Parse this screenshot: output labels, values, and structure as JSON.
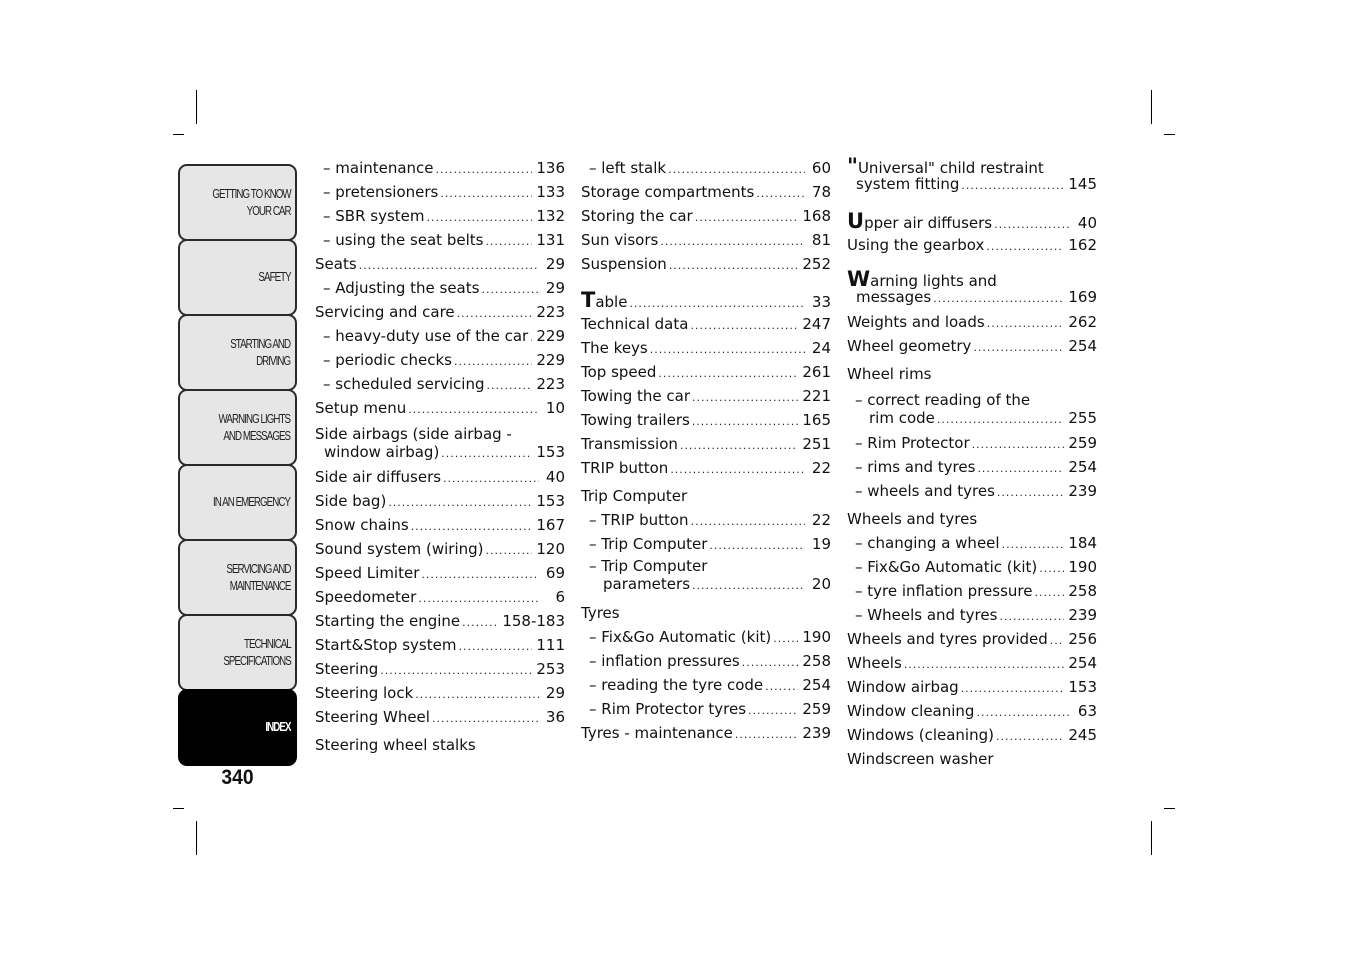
{
  "page_number": "340",
  "section_tabs": [
    {
      "label": "GETTING TO KNOW\nYOUR CAR",
      "active": false
    },
    {
      "label": "SAFETY",
      "active": false
    },
    {
      "label": "STARTING AND\nDRIVING",
      "active": false
    },
    {
      "label": "WARNING LIGHTS\nAND MESSAGES",
      "active": false
    },
    {
      "label": "IN AN EMERGENCY",
      "active": false
    },
    {
      "label": "SERVICING AND\nMAINTENANCE",
      "active": false
    },
    {
      "label": "TECHNICAL\nSPECIFICATIONS",
      "active": false
    },
    {
      "label": "INDEX",
      "active": true
    }
  ],
  "columns": [
    {
      "entries": [
        {
          "text": "– maintenance",
          "page": "136",
          "level": "sub"
        },
        {
          "text": "– pretensioners",
          "page": "133",
          "level": "sub"
        },
        {
          "text": "– SBR system",
          "page": "132",
          "level": "sub"
        },
        {
          "text": "– using the seat belts",
          "page": "131",
          "level": "sub"
        },
        {
          "text": "Seats",
          "page": "29",
          "level": "main"
        },
        {
          "text": "– Adjusting the seats",
          "page": "29",
          "level": "sub"
        },
        {
          "text": "Servicing and care",
          "page": "223",
          "level": "main"
        },
        {
          "text": "– heavy-duty use of the car",
          "page": "229",
          "level": "sub"
        },
        {
          "text": "– periodic checks",
          "page": "229",
          "level": "sub"
        },
        {
          "text": "– scheduled servicing",
          "page": "223",
          "level": "sub"
        },
        {
          "text": "Setup menu",
          "page": "10",
          "level": "main"
        },
        {
          "text": "Side airbags (side airbag -",
          "text2": "window airbag)",
          "page": "153",
          "level": "main"
        },
        {
          "text": "Side air diffusers",
          "page": "40",
          "level": "main"
        },
        {
          "text": "Side bag)",
          "page": "153",
          "level": "main"
        },
        {
          "text": "Snow chains",
          "page": "167",
          "level": "main"
        },
        {
          "text": "Sound system (wiring)",
          "page": "120",
          "level": "main"
        },
        {
          "text": "Speed Limiter",
          "page": "69",
          "level": "main"
        },
        {
          "text": "Speedometer",
          "page": "6",
          "level": "main"
        },
        {
          "text": "Starting the engine",
          "page": "158-183",
          "level": "main"
        },
        {
          "text": "Start&Stop system",
          "page": "111",
          "level": "main"
        },
        {
          "text": "Steering",
          "page": "253",
          "level": "main"
        },
        {
          "text": "Steering lock",
          "page": "29",
          "level": "main"
        },
        {
          "text": "Steering Wheel",
          "page": "36",
          "level": "main"
        },
        {
          "text": "Steering wheel stalks",
          "page": "",
          "level": "head"
        }
      ]
    },
    {
      "entries": [
        {
          "text": "– left stalk",
          "page": "60",
          "level": "sub"
        },
        {
          "text": "Storage compartments",
          "page": "78",
          "level": "main"
        },
        {
          "text": "Storing the car",
          "page": "168",
          "level": "main"
        },
        {
          "text": "Sun visors",
          "page": "81",
          "level": "main"
        },
        {
          "text": "Suspension",
          "page": "252",
          "level": "main"
        },
        {
          "text": "Table",
          "page": "33",
          "level": "main",
          "letter": "T"
        },
        {
          "text": "Technical data",
          "page": "247",
          "level": "main"
        },
        {
          "text": "The keys",
          "page": "24",
          "level": "main"
        },
        {
          "text": "Top speed",
          "page": "261",
          "level": "main"
        },
        {
          "text": "Towing the car",
          "page": "221",
          "level": "main"
        },
        {
          "text": "Towing trailers",
          "page": "165",
          "level": "main"
        },
        {
          "text": "Transmission",
          "page": "251",
          "level": "main"
        },
        {
          "text": "TRIP button",
          "page": "22",
          "level": "main"
        },
        {
          "text": "Trip Computer",
          "page": "",
          "level": "head"
        },
        {
          "text": "– TRIP button",
          "page": "22",
          "level": "sub"
        },
        {
          "text": "– Trip Computer",
          "page": "19",
          "level": "sub"
        },
        {
          "text": "– Trip Computer",
          "text2": "parameters",
          "page": "20",
          "level": "sub"
        },
        {
          "text": "Tyres",
          "page": "",
          "level": "head"
        },
        {
          "text": "– Fix&Go Automatic (kit)",
          "page": "190",
          "level": "sub"
        },
        {
          "text": "– inflation pressures",
          "page": "258",
          "level": "sub"
        },
        {
          "text": "– reading the tyre code",
          "page": "254",
          "level": "sub"
        },
        {
          "text": "– Rim Protector tyres",
          "page": "259",
          "level": "sub"
        },
        {
          "text": "Tyres - maintenance",
          "page": "239",
          "level": "main"
        }
      ]
    },
    {
      "entries": [
        {
          "text": "\"Universal\" child restraint",
          "text2": "system fitting",
          "page": "145",
          "level": "main",
          "letter": "\""
        },
        {
          "text": "Upper air diffusers",
          "page": "40",
          "level": "main",
          "letter": "U"
        },
        {
          "text": "Using the gearbox",
          "page": "162",
          "level": "main"
        },
        {
          "text": "Warning lights and",
          "text2": "messages",
          "page": "169",
          "level": "main",
          "letter": "W"
        },
        {
          "text": "Weights and loads",
          "page": "262",
          "level": "main"
        },
        {
          "text": "Wheel geometry",
          "page": "254",
          "level": "main"
        },
        {
          "text": "Wheel rims",
          "page": "",
          "level": "head"
        },
        {
          "text": "– correct reading of the",
          "text2": "rim code",
          "page": "255",
          "level": "sub"
        },
        {
          "text": "– Rim Protector",
          "page": "259",
          "level": "sub"
        },
        {
          "text": "– rims and tyres",
          "page": "254",
          "level": "sub"
        },
        {
          "text": "– wheels and tyres",
          "page": "239",
          "level": "sub"
        },
        {
          "text": "Wheels and tyres",
          "page": "",
          "level": "head"
        },
        {
          "text": "– changing a wheel",
          "page": "184",
          "level": "sub"
        },
        {
          "text": "– Fix&Go Automatic (kit)",
          "page": "190",
          "level": "sub"
        },
        {
          "text": "– tyre inflation pressure",
          "page": "258",
          "level": "sub"
        },
        {
          "text": "– Wheels and tyres",
          "page": "239",
          "level": "sub"
        },
        {
          "text": "Wheels and tyres provided",
          "page": "256",
          "level": "main"
        },
        {
          "text": "Wheels",
          "page": "254",
          "level": "main"
        },
        {
          "text": "Window airbag",
          "page": "153",
          "level": "main"
        },
        {
          "text": "Window cleaning",
          "page": "63",
          "level": "main"
        },
        {
          "text": "Windows (cleaning)",
          "page": "245",
          "level": "main"
        },
        {
          "text": "Windscreen washer",
          "page": "",
          "level": "head"
        }
      ]
    }
  ]
}
